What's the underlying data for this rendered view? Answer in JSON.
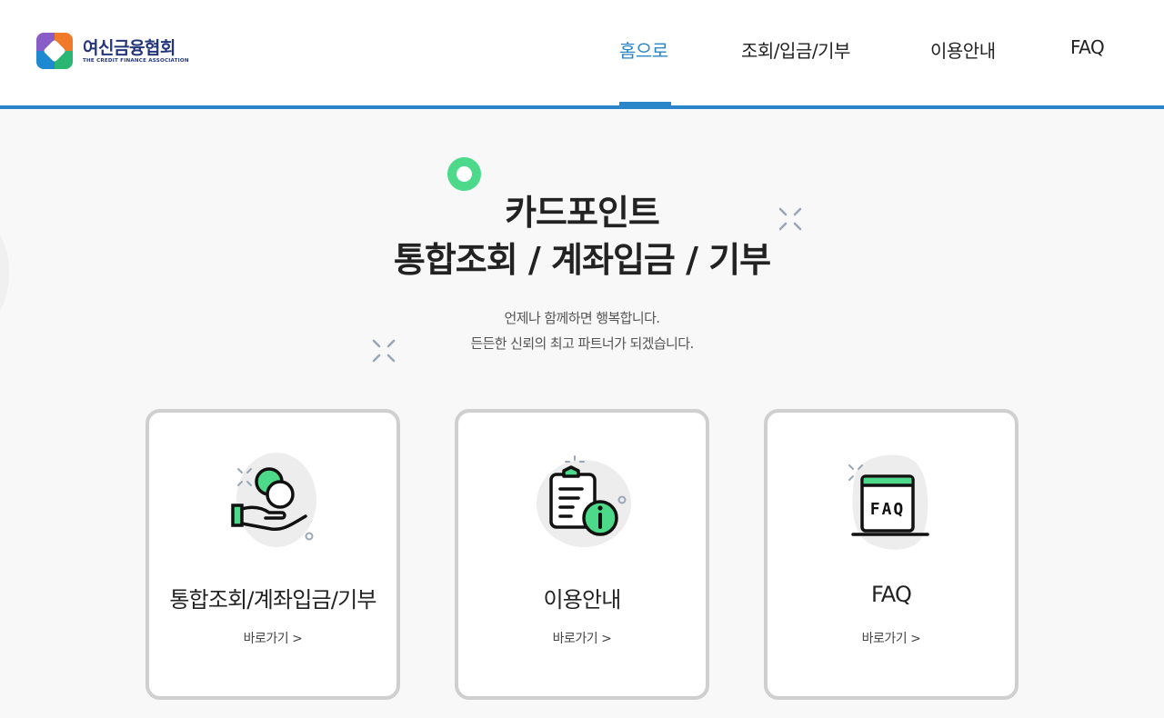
{
  "header": {
    "logo": {
      "korean": "여신금융협회",
      "english": "THE CREDIT FINANCE ASSOCIATION"
    },
    "nav": [
      {
        "label": "홈으로",
        "active": true
      },
      {
        "label": "조회/입금/기부",
        "active": false
      },
      {
        "label": "이용안내",
        "active": false
      },
      {
        "label": "FAQ",
        "active": false
      }
    ]
  },
  "hero": {
    "title_line1": "카드포인트",
    "title_line2": "통합조회 / 계좌입금 / 기부",
    "subtitle_line1": "언제나 함께하면 행복합니다.",
    "subtitle_line2": "든든한 신뢰의 최고 파트너가 되겠습니다."
  },
  "cards": [
    {
      "title": "통합조회/계좌입금/기부",
      "link": "바로가기",
      "icon": "coin-hand-icon"
    },
    {
      "title": "이용안내",
      "link": "바로가기",
      "icon": "clipboard-info-icon"
    },
    {
      "title": "FAQ",
      "link": "바로가기",
      "icon": "faq-board-icon"
    }
  ],
  "colors": {
    "accent": "#2a86c8",
    "green": "#4cd98a",
    "card_border": "#cfcfcf",
    "logo_text": "#24367a"
  }
}
